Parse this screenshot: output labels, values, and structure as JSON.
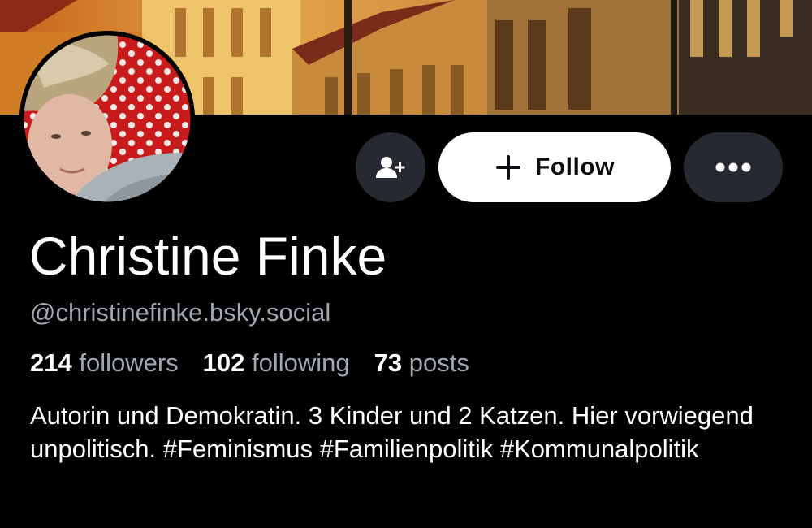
{
  "profile": {
    "display_name": "Christine Finke",
    "handle": "@christinefinke.bsky.social",
    "bio": "Autorin und Demokratin. 3 Kinder und 2 Katzen. Hier vorwiegend unpolitisch. #Feminismus #Familienpolitik #Kommunalpolitik"
  },
  "stats": {
    "followers_count": "214",
    "followers_label": "followers",
    "following_count": "102",
    "following_label": "following",
    "posts_count": "73",
    "posts_label": "posts"
  },
  "actions": {
    "add_user_icon": "person-plus-icon",
    "follow_icon": "plus-icon",
    "follow_label": "Follow",
    "more_icon": "ellipsis-icon"
  },
  "colors": {
    "background": "#000000",
    "button_dark": "#262a30",
    "follow_button": "#ffffff",
    "secondary_text": "#a1a7b0"
  }
}
